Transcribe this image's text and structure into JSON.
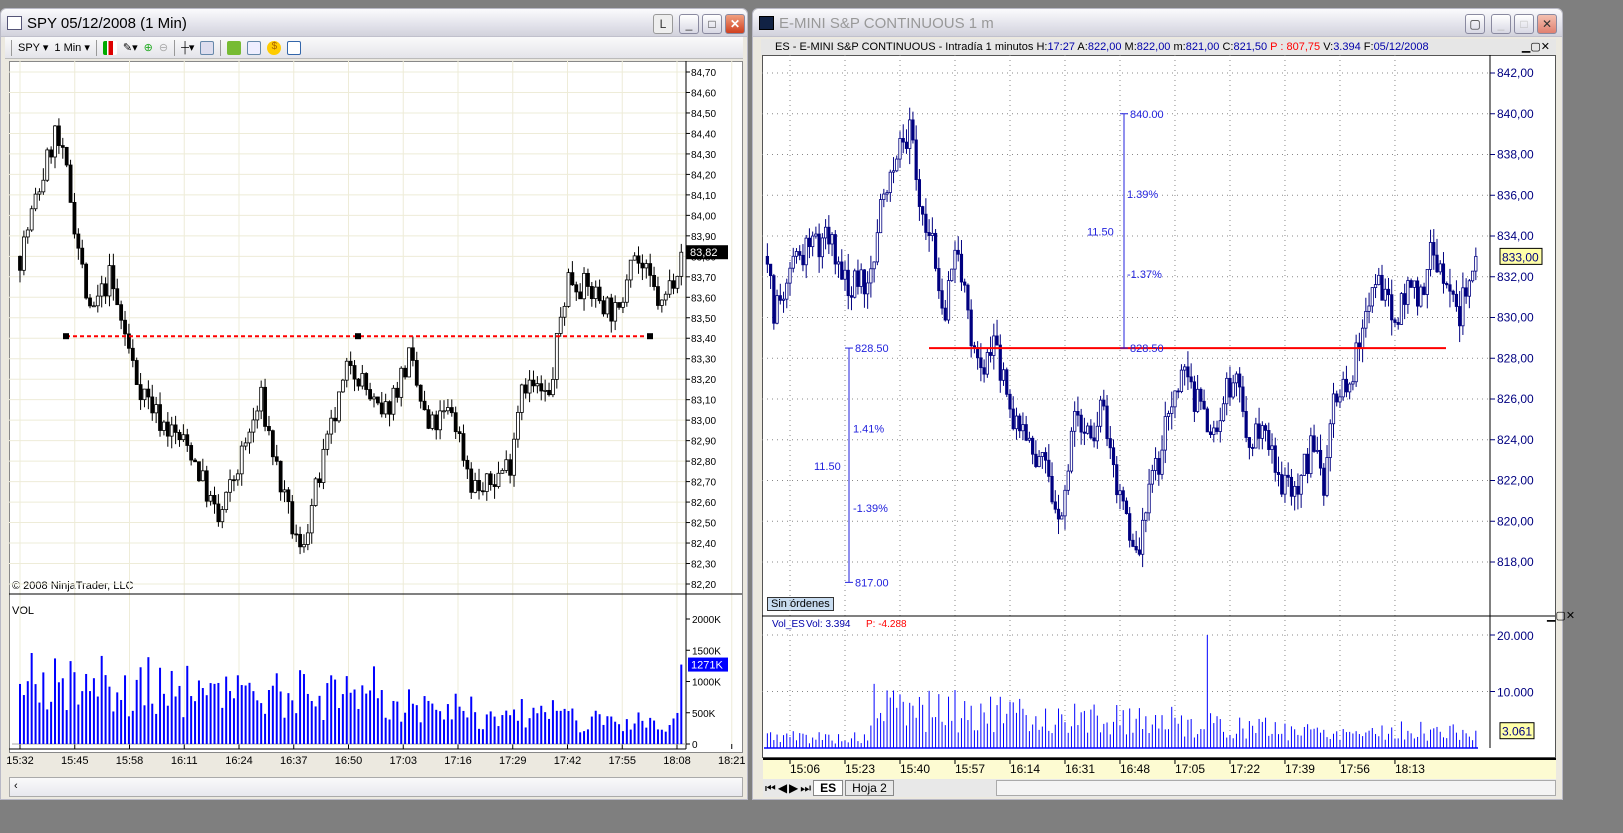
{
  "spy_window": {
    "title": "SPY  05/12/2008 (1 Min)",
    "link_button": "L",
    "toolbar": {
      "instrument": "SPY",
      "interval": "1 Min"
    },
    "copyright": "© 2008 NinjaTrader, LLC",
    "vol_label": "VOL",
    "last_price_tag": "83,82",
    "last_volume_tag": "1271K"
  },
  "es_window": {
    "title": "E-MINI S&P CONTINUOUS 1 m",
    "info": {
      "symbol": "ES - E-MINI S&P CONTINUOUS - Intradía 1 minutos",
      "h_label": "H:",
      "h": "17:27",
      "a_label": "A:",
      "a": "822,00",
      "m_label": "M:",
      "m": "822,00",
      "min_label": "m:",
      "min": "821,00",
      "c_label": "C:",
      "c": "821,50",
      "p": "P : 807,75",
      "v_label": "V:",
      "v": "3.394",
      "f_label": "F:",
      "f": "05/12/2008"
    },
    "orders_label": "Sin órdenes",
    "vol_header": {
      "name": "Vol_ES",
      "vol": "Vol: 3.394",
      "p": "P: -4.288"
    },
    "last_price_tag": "833,00",
    "last_volume_tag": "3.061",
    "tabs": [
      "ES",
      "Hoja 2"
    ],
    "annotations": {
      "right": {
        "top": "840.00",
        "bottom": "828.50",
        "up_pct": "1.39%",
        "range": "11.50",
        "down_pct": "-1.37%"
      },
      "left": {
        "top": "828.50",
        "bottom": "817.00",
        "up_pct": "1.41%",
        "range": "11.50",
        "down_pct": "-1.39%"
      }
    }
  },
  "colors": {
    "es_candle": "#000080",
    "spy_volume": "#0000ff",
    "es_volume": "#0000ff",
    "level_line": "#ff0000"
  },
  "chart_data": [
    {
      "type": "candlestick",
      "title": "SPY 05/12/2008 (1 Min)",
      "ylim": [
        82.2,
        84.7
      ],
      "y_ticks": [
        "82,20",
        "82,30",
        "82,40",
        "82,50",
        "82,60",
        "82,70",
        "82,80",
        "82,90",
        "83,00",
        "83,10",
        "83,20",
        "83,30",
        "83,40",
        "83,50",
        "83,60",
        "83,70",
        "83,80",
        "83,90",
        "84,00",
        "84,10",
        "84,20",
        "84,30",
        "84,40",
        "84,50",
        "84,60",
        "84,70"
      ],
      "x_ticks": [
        "15:32",
        "15:45",
        "15:58",
        "16:11",
        "16:24",
        "16:37",
        "16:50",
        "17:03",
        "17:16",
        "17:29",
        "17:42",
        "17:55",
        "18:08",
        "18:21"
      ],
      "close_path_minutes_from_1532": [
        [
          0,
          83.8
        ],
        [
          9,
          84.4
        ],
        [
          12,
          84.2
        ],
        [
          18,
          83.5
        ],
        [
          23,
          83.7
        ],
        [
          30,
          83.2
        ],
        [
          36,
          83.0
        ],
        [
          44,
          82.85
        ],
        [
          51,
          82.5
        ],
        [
          62,
          83.1
        ],
        [
          68,
          82.6
        ],
        [
          72,
          82.35
        ],
        [
          80,
          82.95
        ],
        [
          85,
          83.3
        ],
        [
          93,
          83.0
        ],
        [
          100,
          83.3
        ],
        [
          105,
          82.95
        ],
        [
          111,
          83.05
        ],
        [
          116,
          82.7
        ],
        [
          119,
          82.65
        ],
        [
          126,
          82.8
        ],
        [
          129,
          83.2
        ],
        [
          136,
          83.1
        ],
        [
          139,
          83.5
        ],
        [
          141,
          83.7
        ],
        [
          149,
          83.6
        ],
        [
          154,
          83.5
        ],
        [
          157,
          83.85
        ],
        [
          165,
          83.55
        ],
        [
          170,
          83.82
        ]
      ],
      "support_line": 83.41,
      "volume": {
        "ylim_k": [
          0,
          2000
        ],
        "y_ticks": [
          "0",
          "500K",
          "1000K",
          "1500K",
          "2000K"
        ],
        "level_path_k": [
          [
            0,
            1300
          ],
          [
            20,
            1200
          ],
          [
            40,
            1100
          ],
          [
            60,
            900
          ],
          [
            80,
            1000
          ],
          [
            100,
            750
          ],
          [
            120,
            650
          ],
          [
            140,
            550
          ],
          [
            160,
            450
          ],
          [
            170,
            450
          ]
        ],
        "last_k": 1271
      }
    },
    {
      "type": "candlestick",
      "title": "E-MINI S&P CONTINUOUS 1 m",
      "ylim": [
        816,
        843
      ],
      "y_ticks": [
        "818,00",
        "820,00",
        "822,00",
        "824,00",
        "826,00",
        "828,00",
        "830,00",
        "832,00",
        "834,00",
        "836,00",
        "838,00",
        "840,00",
        "842,00"
      ],
      "x_ticks": [
        "15:06",
        "15:23",
        "15:40",
        "15:57",
        "16:14",
        "16:31",
        "16:48",
        "17:05",
        "17:22",
        "17:39",
        "17:56",
        "18:13"
      ],
      "close_path_minutes_from_1500": [
        [
          -1,
          833
        ],
        [
          1,
          830.5
        ],
        [
          6,
          832
        ],
        [
          12,
          833.5
        ],
        [
          18,
          834
        ],
        [
          25,
          831.5
        ],
        [
          31,
          832
        ],
        [
          35,
          836
        ],
        [
          40,
          838
        ],
        [
          43,
          839
        ],
        [
          46,
          836
        ],
        [
          51,
          833
        ],
        [
          54,
          830
        ],
        [
          57,
          834
        ],
        [
          60,
          831
        ],
        [
          63,
          828.5
        ],
        [
          66,
          827
        ],
        [
          69,
          829
        ],
        [
          74,
          825.5
        ],
        [
          80,
          824
        ],
        [
          85,
          822.5
        ],
        [
          90,
          820
        ],
        [
          94,
          825
        ],
        [
          99,
          824
        ],
        [
          102,
          826
        ],
        [
          106,
          822
        ],
        [
          111,
          819.5
        ],
        [
          113,
          818
        ],
        [
          116,
          821
        ],
        [
          120,
          823
        ],
        [
          124,
          826
        ],
        [
          127,
          827.5
        ],
        [
          131,
          826
        ],
        [
          136,
          824.5
        ],
        [
          139,
          825.5
        ],
        [
          144,
          827.5
        ],
        [
          148,
          824
        ],
        [
          153,
          825
        ],
        [
          157,
          822
        ],
        [
          162,
          821
        ],
        [
          167,
          823.5
        ],
        [
          171,
          822
        ],
        [
          174,
          826.5
        ],
        [
          179,
          827
        ],
        [
          184,
          830
        ],
        [
          188,
          832
        ],
        [
          193,
          829.5
        ],
        [
          198,
          832
        ],
        [
          201,
          831
        ],
        [
          204,
          833.5
        ],
        [
          209,
          832
        ],
        [
          213,
          830
        ],
        [
          216,
          832
        ],
        [
          218,
          833
        ]
      ],
      "level_line": 828.5,
      "volume": {
        "ylim": [
          0,
          20000
        ],
        "y_ticks": [
          "10.000",
          "20.000"
        ],
        "level_path": [
          [
            -1,
            2500
          ],
          [
            30,
            2000
          ],
          [
            32,
            8500
          ],
          [
            60,
            7500
          ],
          [
            90,
            6000
          ],
          [
            115,
            6000
          ],
          [
            140,
            4500
          ],
          [
            170,
            3500
          ],
          [
            200,
            3500
          ],
          [
            218,
            3000
          ]
        ],
        "last": 3061
      }
    }
  ]
}
